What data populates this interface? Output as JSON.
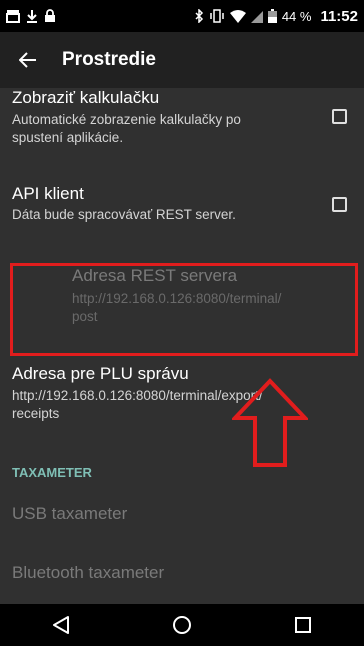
{
  "status_bar": {
    "battery_percent": "44 %",
    "time": "11:52"
  },
  "app_bar": {
    "title": "Prostredie"
  },
  "preferences": {
    "calculator": {
      "title": "Zobraziť kalkulačku",
      "summary_line1": "Automatické zobrazenie kalkulačky po",
      "summary_line2": "spustení aplikácie.",
      "checked": false
    },
    "api_client": {
      "title": "API klient",
      "summary": "Dáta bude spracovávať REST server.",
      "checked": false
    },
    "rest_address": {
      "title": "Adresa REST servera",
      "summary_line1": "http://192.168.0.126:8080/terminal/",
      "summary_line2": "post",
      "enabled": false
    },
    "plu_address": {
      "title": "Adresa pre PLU správu",
      "summary_line1": "http://192.168.0.126:8080/terminal/export/",
      "summary_line2": "receipts"
    },
    "taxameter_category": "TAXAMETER",
    "usb_taxameter": {
      "title": "USB taxameter",
      "enabled": false
    },
    "bluetooth_taxameter": {
      "title": "Bluetooth taxameter",
      "enabled": false
    }
  },
  "colors": {
    "accent": "#7fbfb5",
    "highlight": "#e11d1d",
    "background": "#303030",
    "app_bar": "#212121"
  }
}
